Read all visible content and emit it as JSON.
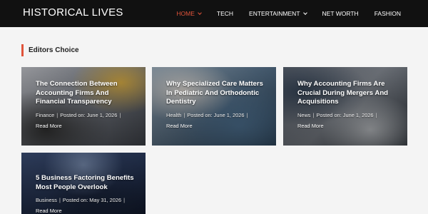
{
  "header": {
    "brand": "HISTORICAL LIVES",
    "nav": [
      {
        "label": "HOME",
        "active": true,
        "has_dropdown": true
      },
      {
        "label": "TECH",
        "active": false,
        "has_dropdown": false
      },
      {
        "label": "ENTERTAINMENT",
        "active": false,
        "has_dropdown": true
      },
      {
        "label": "NET WORTH",
        "active": false,
        "has_dropdown": false
      },
      {
        "label": "FASHION",
        "active": false,
        "has_dropdown": false
      }
    ]
  },
  "section": {
    "title": "Editors Choice"
  },
  "posts": [
    {
      "title": "The Connection Between Accounting Firms And Financial Transparency",
      "category": "Finance",
      "posted": "Posted on: June 1, 2026",
      "read_more": "Read More"
    },
    {
      "title": "Why Specialized Care Matters In Pediatric And Orthodontic Dentistry",
      "category": "Health",
      "posted": "Posted on: June 1, 2026",
      "read_more": "Read More"
    },
    {
      "title": "Why Accounting Firms Are Crucial During Mergers And Acquisitions",
      "category": "News",
      "posted": "Posted on: June 1, 2026",
      "read_more": "Read More"
    },
    {
      "title": "5 Business Factoring Benefits Most People Overlook",
      "category": "Business",
      "posted": "Posted on: May 31, 2026",
      "read_more": "Read More"
    }
  ],
  "colors": {
    "accent": "#e0533a",
    "topbar": "#111111",
    "background": "#f4f4f4"
  }
}
